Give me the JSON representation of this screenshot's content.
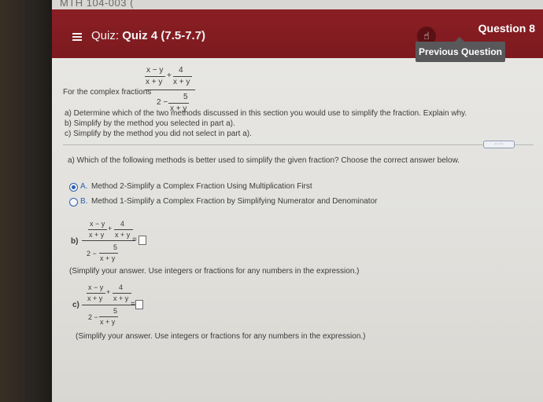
{
  "browser": {
    "tab_text": "MTH 104-003 ("
  },
  "header": {
    "menu_icon": "hamburger-icon",
    "quiz_prefix": "Quiz:",
    "quiz_title": "Quiz 4 (7.5-7.7)",
    "question": "Question 8",
    "previous_button": "Previous Question"
  },
  "colors": {
    "header": "#7c1a1f",
    "radio": "#2d5fae",
    "button": "#58585a"
  },
  "problem": {
    "intro": "For the complex fractions",
    "num_a_top": "x − y",
    "num_a_bot": "x + y",
    "plus": "+",
    "num_b_top": "4",
    "num_b_bot": "x + y",
    "den_prefix": "2 −",
    "den_top": "5",
    "den_bot": "x + y",
    "task_a": "a) Determine which of the two methods discussed in this section you would use to simplify the fraction. Explain why.",
    "task_b": "b) Simplify by the method you selected in part a).",
    "task_c": "c) Simplify by the method you did not select in part a)."
  },
  "more_button": "·····",
  "part_a": {
    "question": "a) Which of the following methods is better used to simplify the given fraction? Choose the correct answer below.",
    "options": [
      {
        "letter": "A.",
        "text": "Method 2-Simplify a Complex Fraction Using Multiplication First",
        "selected": true
      },
      {
        "letter": "B.",
        "text": "Method 1-Simplify a Complex Fraction by Simplifying Numerator and Denominator",
        "selected": false
      }
    ]
  },
  "part_b": {
    "label": "b)",
    "equals": "=",
    "hint": "(Simplify your answer. Use integers or fractions for any numbers in the expression.)"
  },
  "part_c": {
    "label": "c)",
    "equals": "=",
    "hint": "(Simplify your answer. Use integers or fractions for any numbers in the expression.)"
  }
}
